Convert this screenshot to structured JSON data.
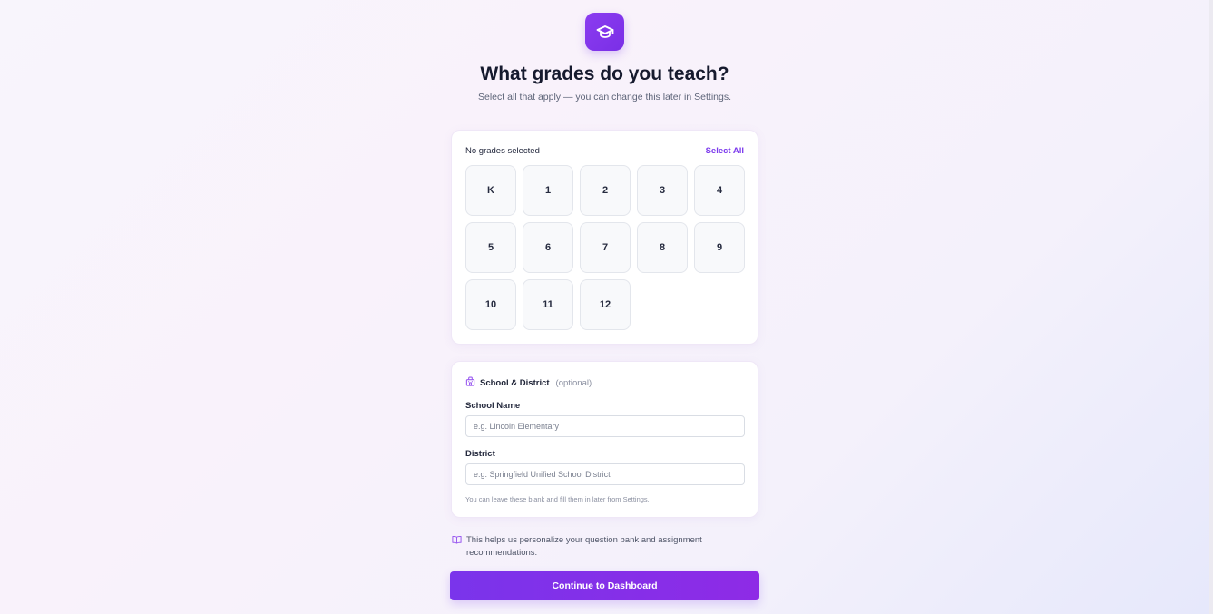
{
  "header": {
    "logo_icon": "graduation-cap-icon",
    "title": "What grades do you teach?",
    "subtitle": "Select all that apply — you can change this later in Settings."
  },
  "grades": {
    "status": "No grades selected",
    "select_all_label": "Select All",
    "items": [
      "K",
      "1",
      "2",
      "3",
      "4",
      "5",
      "6",
      "7",
      "8",
      "9",
      "10",
      "11",
      "12"
    ]
  },
  "school": {
    "icon": "school-icon",
    "heading": "School & District",
    "optional_label": "(optional)",
    "school_name_label": "School Name",
    "school_name_placeholder": "e.g. Lincoln Elementary",
    "school_name_value": "",
    "district_label": "District",
    "district_placeholder": "e.g. Springfield Unified School District",
    "district_value": "",
    "hint": "You can leave these blank and fill them in later from Settings."
  },
  "info": {
    "icon": "book-open-icon",
    "text": "This helps us personalize your question bank and assignment recommendations."
  },
  "cta": {
    "label": "Continue to Dashboard"
  },
  "colors": {
    "accent": "#7c3aed",
    "card_bg": "#ffffff",
    "tile_bg": "#f8f9fb"
  }
}
